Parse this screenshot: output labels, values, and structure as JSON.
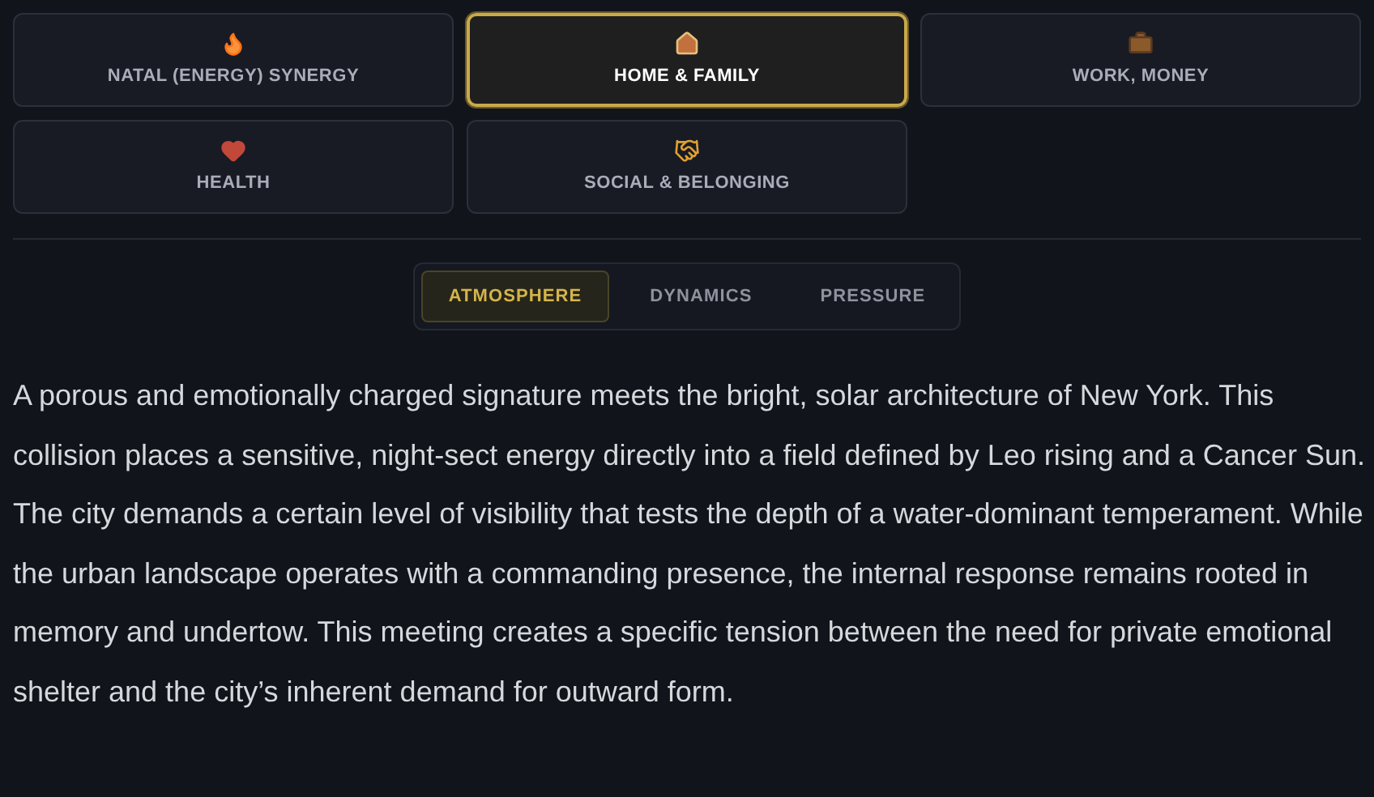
{
  "categories": [
    {
      "kind": "flame",
      "label": "NATAL (ENERGY) SYNERGY",
      "selected": false
    },
    {
      "kind": "house",
      "label": "HOME & FAMILY",
      "selected": true
    },
    {
      "kind": "briefcase",
      "label": "WORK, MONEY",
      "selected": false
    },
    {
      "kind": "heart",
      "label": "HEALTH",
      "selected": false
    },
    {
      "kind": "handshake",
      "label": "SOCIAL & BELONGING",
      "selected": false
    }
  ],
  "tabs": [
    {
      "label": "ATMOSPHERE",
      "selected": true
    },
    {
      "label": "DYNAMICS",
      "selected": false
    },
    {
      "label": "PRESSURE",
      "selected": false
    }
  ],
  "body": "A porous and emotionally charged signature meets the bright, solar architecture of New York. This collision places a sensitive, night-sect energy directly into a field defined by Leo rising and a Cancer Sun. The city demands a certain level of visibility that tests the depth of a water-dominant temperament. While the urban landscape operates with a commanding presence, the internal response remains rooted in memory and undertow. This meeting creates a specific tension between the need for private emotional shelter and the city’s inherent demand for outward form."
}
